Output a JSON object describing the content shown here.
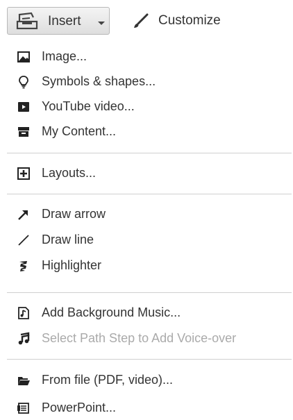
{
  "toolbar": {
    "insert_label": "Insert",
    "customize_label": "Customize"
  },
  "menu": {
    "items": [
      {
        "label": "Image...",
        "icon": "image-icon"
      },
      {
        "label": "Symbols & shapes...",
        "icon": "lightbulb-icon"
      },
      {
        "label": "YouTube video...",
        "icon": "youtube-icon"
      },
      {
        "label": "My Content...",
        "icon": "archive-box-icon"
      },
      {
        "label": "Layouts...",
        "icon": "plus-square-icon"
      },
      {
        "label": "Draw arrow",
        "icon": "arrow-icon"
      },
      {
        "label": "Draw line",
        "icon": "line-icon"
      },
      {
        "label": "Highlighter",
        "icon": "highlighter-icon"
      },
      {
        "label": "Add Background Music...",
        "icon": "music-file-icon"
      },
      {
        "label": "Select Path Step to Add Voice-over",
        "icon": "music-note-icon",
        "disabled": true
      },
      {
        "label": "From file (PDF, video)...",
        "icon": "folder-open-icon"
      },
      {
        "label": "PowerPoint...",
        "icon": "powerpoint-icon"
      }
    ]
  },
  "colors": {
    "text": "#333333",
    "disabled_text": "#aaaaaa",
    "separator": "#cfcfcf"
  }
}
